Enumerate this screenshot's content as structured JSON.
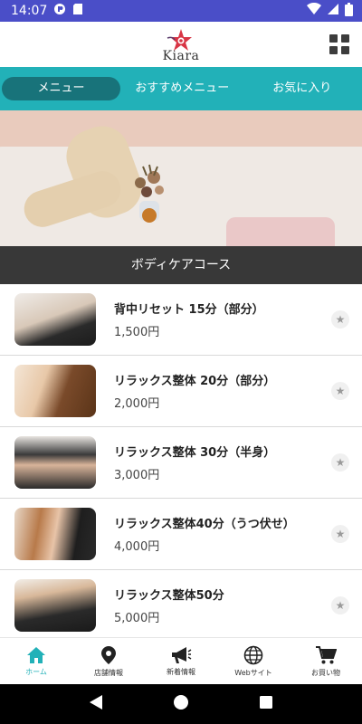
{
  "status_bar": {
    "time": "14:07",
    "left_icons": [
      "app-notification-icon",
      "sd-card-icon"
    ],
    "right_icons": [
      "wifi-icon",
      "signal-icon",
      "battery-icon"
    ]
  },
  "header": {
    "logo_text": "Kiara",
    "menu_icon": "grid-menu-icon"
  },
  "tabs": [
    {
      "label": "メニュー",
      "active": true
    },
    {
      "label": "おすすめメニュー",
      "active": false
    },
    {
      "label": "お気に入り",
      "active": false
    }
  ],
  "section": {
    "title": "ボディケアコース"
  },
  "items": [
    {
      "name": "背中リセット 15分（部分）",
      "price": "1,500円"
    },
    {
      "name": "リラックス整体 20分（部分）",
      "price": "2,000円"
    },
    {
      "name": "リラックス整体 30分（半身）",
      "price": "3,000円"
    },
    {
      "name": "リラックス整体40分（うつ伏せ）",
      "price": "4,000円"
    },
    {
      "name": "リラックス整体50分",
      "price": "5,000円"
    }
  ],
  "bottom_nav": [
    {
      "label": "ホーム",
      "icon": "home-icon",
      "active": true
    },
    {
      "label": "店舗情報",
      "icon": "map-pin-icon",
      "active": false
    },
    {
      "label": "新着情報",
      "icon": "megaphone-icon",
      "active": false
    },
    {
      "label": "Webサイト",
      "icon": "globe-icon",
      "active": false
    },
    {
      "label": "お買い物",
      "icon": "cart-icon",
      "active": false
    }
  ],
  "colors": {
    "accent": "#22b1b8",
    "accent_dark": "#18737a",
    "status_bar": "#4a4ec8",
    "section_bar": "#383838"
  }
}
